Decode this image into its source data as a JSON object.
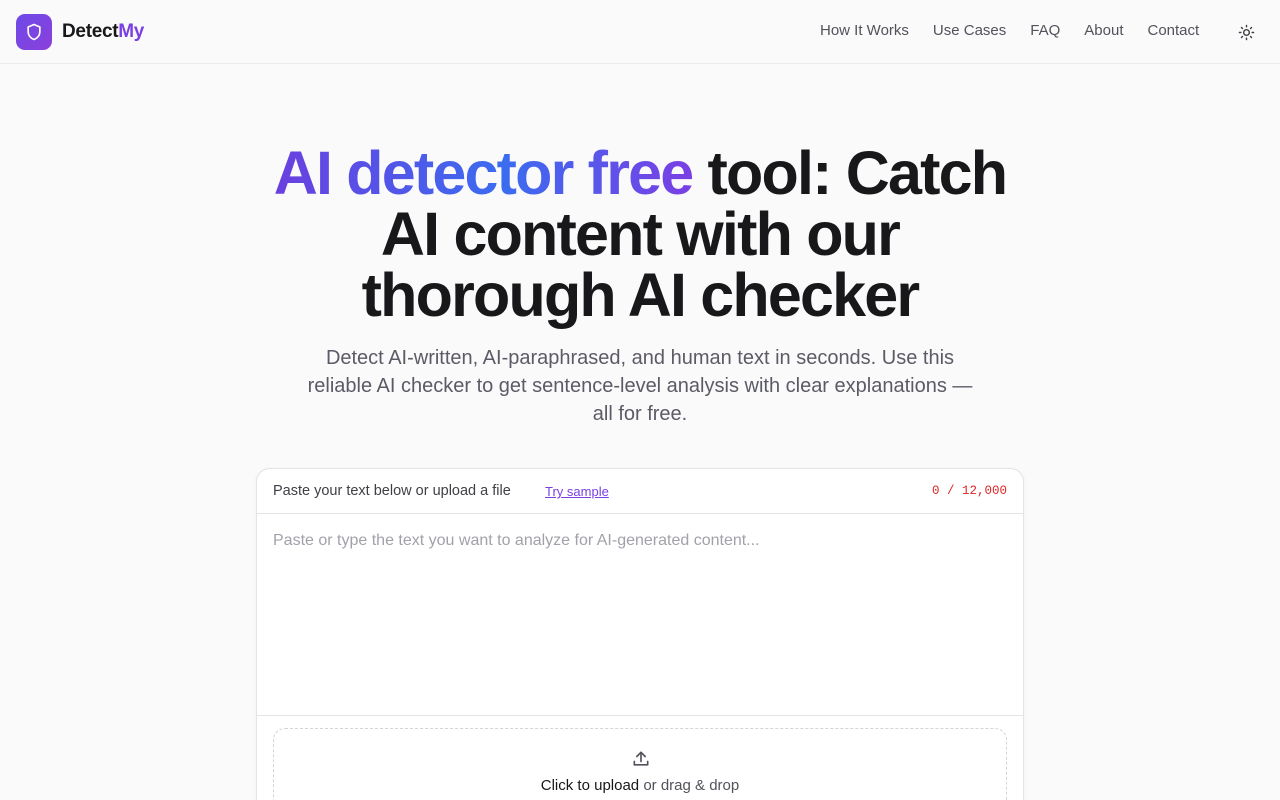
{
  "brand": {
    "name_part1": "Detect",
    "name_part2": "My",
    "logo_icon": "shield-icon"
  },
  "nav": {
    "links": [
      {
        "label": "How It Works"
      },
      {
        "label": "Use Cases"
      },
      {
        "label": "FAQ"
      },
      {
        "label": "About"
      },
      {
        "label": "Contact"
      }
    ],
    "theme_toggle_icon": "sun-icon"
  },
  "hero": {
    "title_highlight": "AI detector free",
    "title_rest_line1": " tool: Catch",
    "title_line2": "AI content with our",
    "title_line3": "thorough AI checker",
    "subtitle": "Detect AI-written, AI-paraphrased, and human text in seconds. Use this reliable AI checker to get sentence-level analysis with clear explanations — all for free."
  },
  "input_card": {
    "label": "Paste your text below or upload a file",
    "sample_link": "Try sample",
    "char_count": "0 / 12,000",
    "placeholder": "Paste or type the text you want to analyze for AI-generated content...",
    "value": "",
    "upload": {
      "icon": "upload-icon",
      "primary": "Click to upload",
      "secondary": " or drag & drop"
    }
  },
  "colors": {
    "accent": "#7b3fe4",
    "gradient_start": "#6a3fe0",
    "gradient_mid": "#3b6cf0",
    "counter_red": "#dc2626"
  }
}
